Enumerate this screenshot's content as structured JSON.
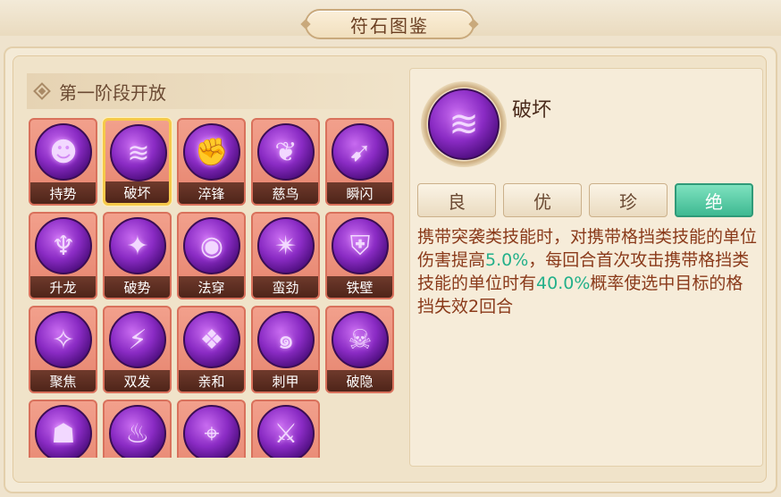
{
  "window": {
    "title": "符石图鉴"
  },
  "stage": {
    "title": "第一阶段开放"
  },
  "runes": [
    {
      "name": "持势",
      "icon": "demon-icon",
      "glyph": "☻"
    },
    {
      "name": "破坏",
      "icon": "slash-icon",
      "glyph": "≋",
      "selected": true
    },
    {
      "name": "淬锋",
      "icon": "fist-icon",
      "glyph": "✊"
    },
    {
      "name": "慈鸟",
      "icon": "phoenix-icon",
      "glyph": "❦"
    },
    {
      "name": "瞬闪",
      "icon": "dash-icon",
      "glyph": "➹"
    },
    {
      "name": "升龙",
      "icon": "rising-icon",
      "glyph": "♆"
    },
    {
      "name": "破势",
      "icon": "kick-icon",
      "glyph": "✦"
    },
    {
      "name": "法穿",
      "icon": "orb-icon",
      "glyph": "◉"
    },
    {
      "name": "蛮劲",
      "icon": "strike-icon",
      "glyph": "✴"
    },
    {
      "name": "铁壁",
      "icon": "armor-icon",
      "glyph": "⛨"
    },
    {
      "name": "聚焦",
      "icon": "focus-icon",
      "glyph": "✧"
    },
    {
      "name": "双发",
      "icon": "double-slash-icon",
      "glyph": "⚡"
    },
    {
      "name": "亲和",
      "icon": "heart-shield-icon",
      "glyph": "❖"
    },
    {
      "name": "刺甲",
      "icon": "spiral-icon",
      "glyph": "๑"
    },
    {
      "name": "破隐",
      "icon": "shadow-icon",
      "glyph": "☠"
    },
    {
      "name": "",
      "icon": "mask-icon",
      "glyph": "☗"
    },
    {
      "name": "",
      "icon": "flame-icon",
      "glyph": "♨"
    },
    {
      "name": "",
      "icon": "target-icon",
      "glyph": "⌖"
    },
    {
      "name": "",
      "icon": "sword-icon",
      "glyph": "⚔"
    }
  ],
  "detail": {
    "name": "破坏",
    "icon": "slash-icon",
    "glyph": "≋",
    "grades": [
      {
        "label": "良",
        "active": false
      },
      {
        "label": "优",
        "active": false
      },
      {
        "label": "珍",
        "active": false
      },
      {
        "label": "绝",
        "active": true
      }
    ],
    "description": {
      "part1": "携带突袭类技能时，对携带格挡类技能的单位伤害提高",
      "value1": "5.0%",
      "part2": "，每回合首次攻击携带格挡类技能的单位时有",
      "value2": "40.0%",
      "part3": "概率使选中目标的格挡失效2回合"
    }
  },
  "colors": {
    "accent_green": "#23b08a",
    "text_brown": "#8a3a1a",
    "cell_bg": "#e6846e",
    "selected_border": "#f5c94a"
  }
}
